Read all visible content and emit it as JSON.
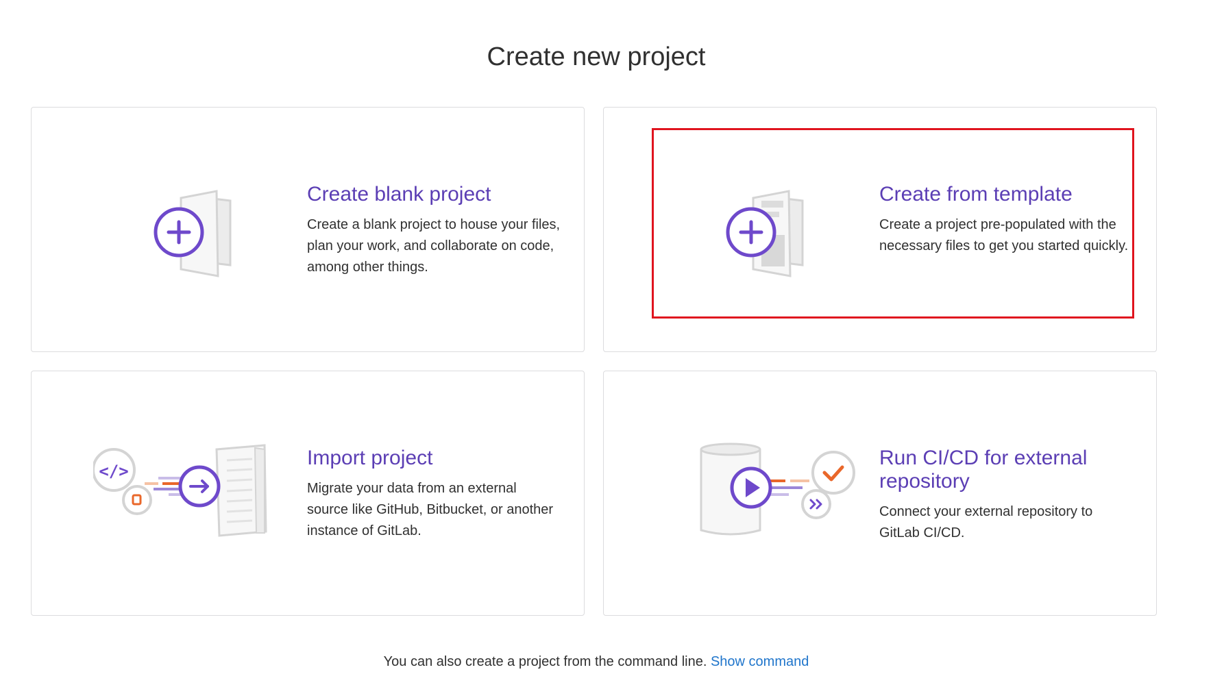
{
  "page": {
    "title": "Create new project"
  },
  "cards": [
    {
      "title": "Create blank project",
      "description": "Create a blank project to house your files, plan your work, and collaborate on code, among other things.",
      "icon": "new-project-icon"
    },
    {
      "title": "Create from template",
      "description": "Create a project pre-populated with the necessary files to get you started quickly.",
      "icon": "template-project-icon"
    },
    {
      "title": "Import project",
      "description": "Migrate your data from an external source like GitHub, Bitbucket, or another instance of GitLab.",
      "icon": "import-project-icon"
    },
    {
      "title": "Run CI/CD for external repository",
      "description": "Connect your external repository to GitLab CI/CD.",
      "icon": "cicd-external-icon"
    }
  ],
  "footer": {
    "text": "You can also create a project from the command line.",
    "link_label": "Show command"
  },
  "colors": {
    "accent": "#5b3eb4",
    "link": "#1f75cb",
    "highlight": "#e0141e",
    "orange": "#e9672a"
  }
}
